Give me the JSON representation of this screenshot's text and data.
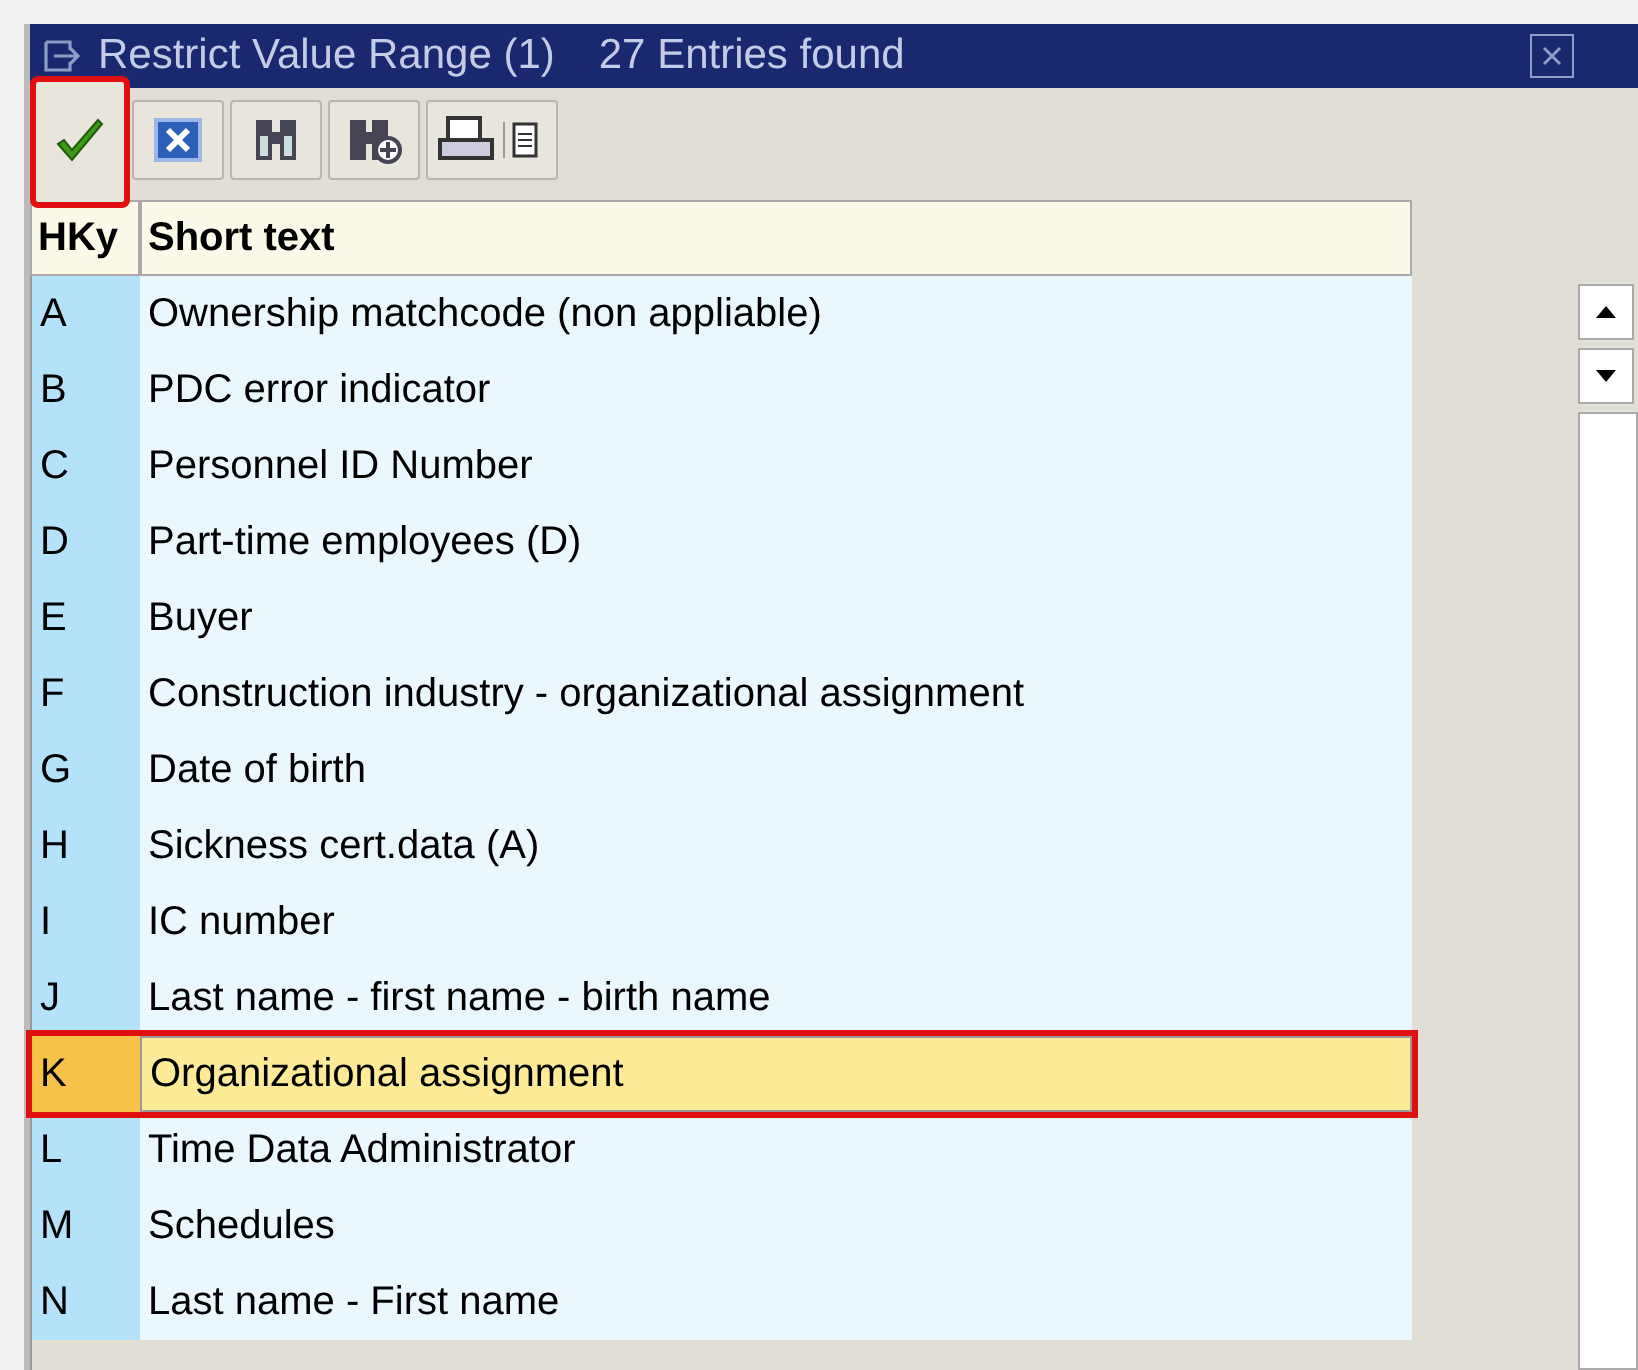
{
  "window": {
    "title": "Restrict Value Range (1)",
    "subtitle": "27 Entries found"
  },
  "toolbar": [
    {
      "kind": "check",
      "highlighted": true
    },
    {
      "kind": "cancel",
      "highlighted": false
    },
    {
      "kind": "find",
      "highlighted": false
    },
    {
      "kind": "find-more",
      "highlighted": false
    },
    {
      "kind": "print",
      "highlighted": false
    }
  ],
  "table": {
    "columns": [
      "HKy",
      "Short text"
    ],
    "rows": [
      {
        "key": "A",
        "text": "Ownership matchcode (non appliable)",
        "selected": false,
        "highlighted": false
      },
      {
        "key": "B",
        "text": "PDC error indicator",
        "selected": false,
        "highlighted": false
      },
      {
        "key": "C",
        "text": "Personnel ID Number",
        "selected": false,
        "highlighted": false
      },
      {
        "key": "D",
        "text": "Part-time employees (D)",
        "selected": false,
        "highlighted": false
      },
      {
        "key": "E",
        "text": "Buyer",
        "selected": false,
        "highlighted": false
      },
      {
        "key": "F",
        "text": "Construction industry - organizational assignment",
        "selected": false,
        "highlighted": false
      },
      {
        "key": "G",
        "text": "Date of birth",
        "selected": false,
        "highlighted": false
      },
      {
        "key": "H",
        "text": "Sickness cert.data (A)",
        "selected": false,
        "highlighted": false
      },
      {
        "key": "I",
        "text": "IC number",
        "selected": false,
        "highlighted": false
      },
      {
        "key": "J",
        "text": "Last name - first name - birth name",
        "selected": false,
        "highlighted": false
      },
      {
        "key": "K",
        "text": "Organizational assignment",
        "selected": true,
        "highlighted": true
      },
      {
        "key": "L",
        "text": "Time Data Administrator",
        "selected": false,
        "highlighted": false
      },
      {
        "key": "M",
        "text": "Schedules",
        "selected": false,
        "highlighted": false
      },
      {
        "key": "N",
        "text": "Last name - First name",
        "selected": false,
        "highlighted": false
      }
    ]
  }
}
